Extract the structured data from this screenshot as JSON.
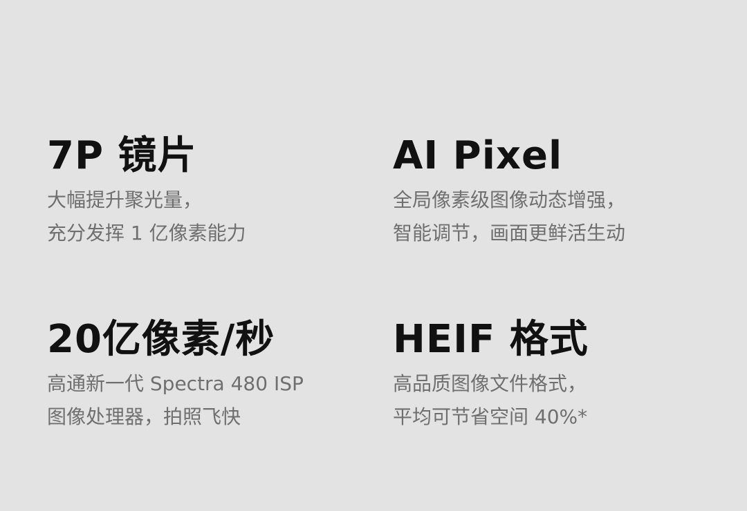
{
  "features": [
    {
      "title": "7P 镜片",
      "lines": [
        "大幅提升聚光量，",
        "充分发挥 1 亿像素能力"
      ]
    },
    {
      "title": "AI Pixel",
      "lines": [
        "全局像素级图像动态增强，",
        "智能调节，画面更鲜活生动"
      ]
    },
    {
      "title": "20亿像素/秒",
      "lines": [
        "高通新一代 Spectra 480 ISP",
        "图像处理器，拍照飞快"
      ]
    },
    {
      "title": "HEIF 格式",
      "lines": [
        "高品质图像文件格式，",
        "平均可节省空间 40%*"
      ]
    }
  ]
}
